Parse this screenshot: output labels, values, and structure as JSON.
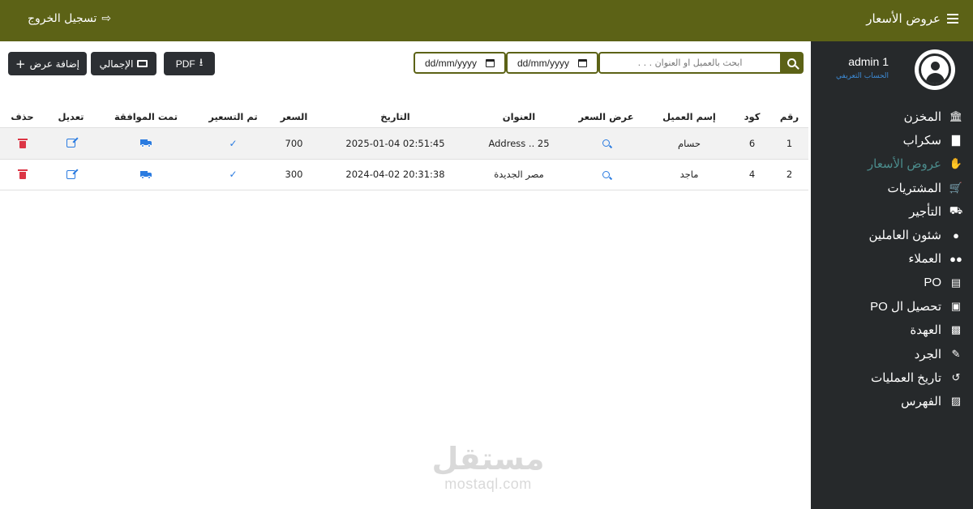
{
  "header": {
    "title": "عروض الأسعار",
    "logout_label": "تسجيل الخروج",
    "bg_color": "#5c6216"
  },
  "sidebar": {
    "user": {
      "name": "admin 1",
      "role": "الحساب التعريفي"
    },
    "items": [
      {
        "label": "المخزن",
        "icon": "warehouse-icon"
      },
      {
        "label": "سكراب",
        "icon": "scrap-icon"
      },
      {
        "label": "عروض الأسعار",
        "icon": "hand-money-icon",
        "active": true
      },
      {
        "label": "المشتريات",
        "icon": "cart-icon"
      },
      {
        "label": "التأجير",
        "icon": "rental-icon"
      },
      {
        "label": "شئون العاملين",
        "icon": "user-icon"
      },
      {
        "label": "العملاء",
        "icon": "users-icon"
      },
      {
        "label": "PO",
        "icon": "money-card-icon"
      },
      {
        "label": "تحصيل ال PO",
        "icon": "money-bill-icon"
      },
      {
        "label": "العهدة",
        "icon": "id-card-icon"
      },
      {
        "label": "الجرد",
        "icon": "edit-icon"
      },
      {
        "label": "تاريخ العمليات",
        "icon": "history-icon"
      },
      {
        "label": "الفهرس",
        "icon": "address-book-icon"
      }
    ]
  },
  "toolbar": {
    "add_offer_label": "إضافة عرض",
    "total_label": "الإجمالي",
    "pdf_label": "PDF",
    "date_from_placeholder": "dd/mm/yyyy",
    "date_to_placeholder": "dd/mm/yyyy",
    "search_placeholder": "ابحث بالعميل او العنوان . . ."
  },
  "table": {
    "headers": {
      "num": "رقم",
      "code": "كود",
      "client": "إسم العميل",
      "offer": "عرض السعر",
      "address": "العنوان",
      "date": "التاريخ",
      "price": "السعر",
      "priced": "تم التسعير",
      "approved": "تمت الموافقة",
      "edit": "تعديل",
      "delete": "حذف"
    },
    "rows": [
      {
        "num": "1",
        "code": "6",
        "client": "حسام",
        "address": "Address .. 25",
        "date": "2025-01-04 02:51:45",
        "price": "700"
      },
      {
        "num": "2",
        "code": "4",
        "client": "ماجد",
        "address": "مصر الجديدة",
        "date": "2024-04-02 20:31:38",
        "price": "300"
      }
    ]
  },
  "watermark": {
    "arabic": "مستقل",
    "latin": "mostaql.com"
  }
}
